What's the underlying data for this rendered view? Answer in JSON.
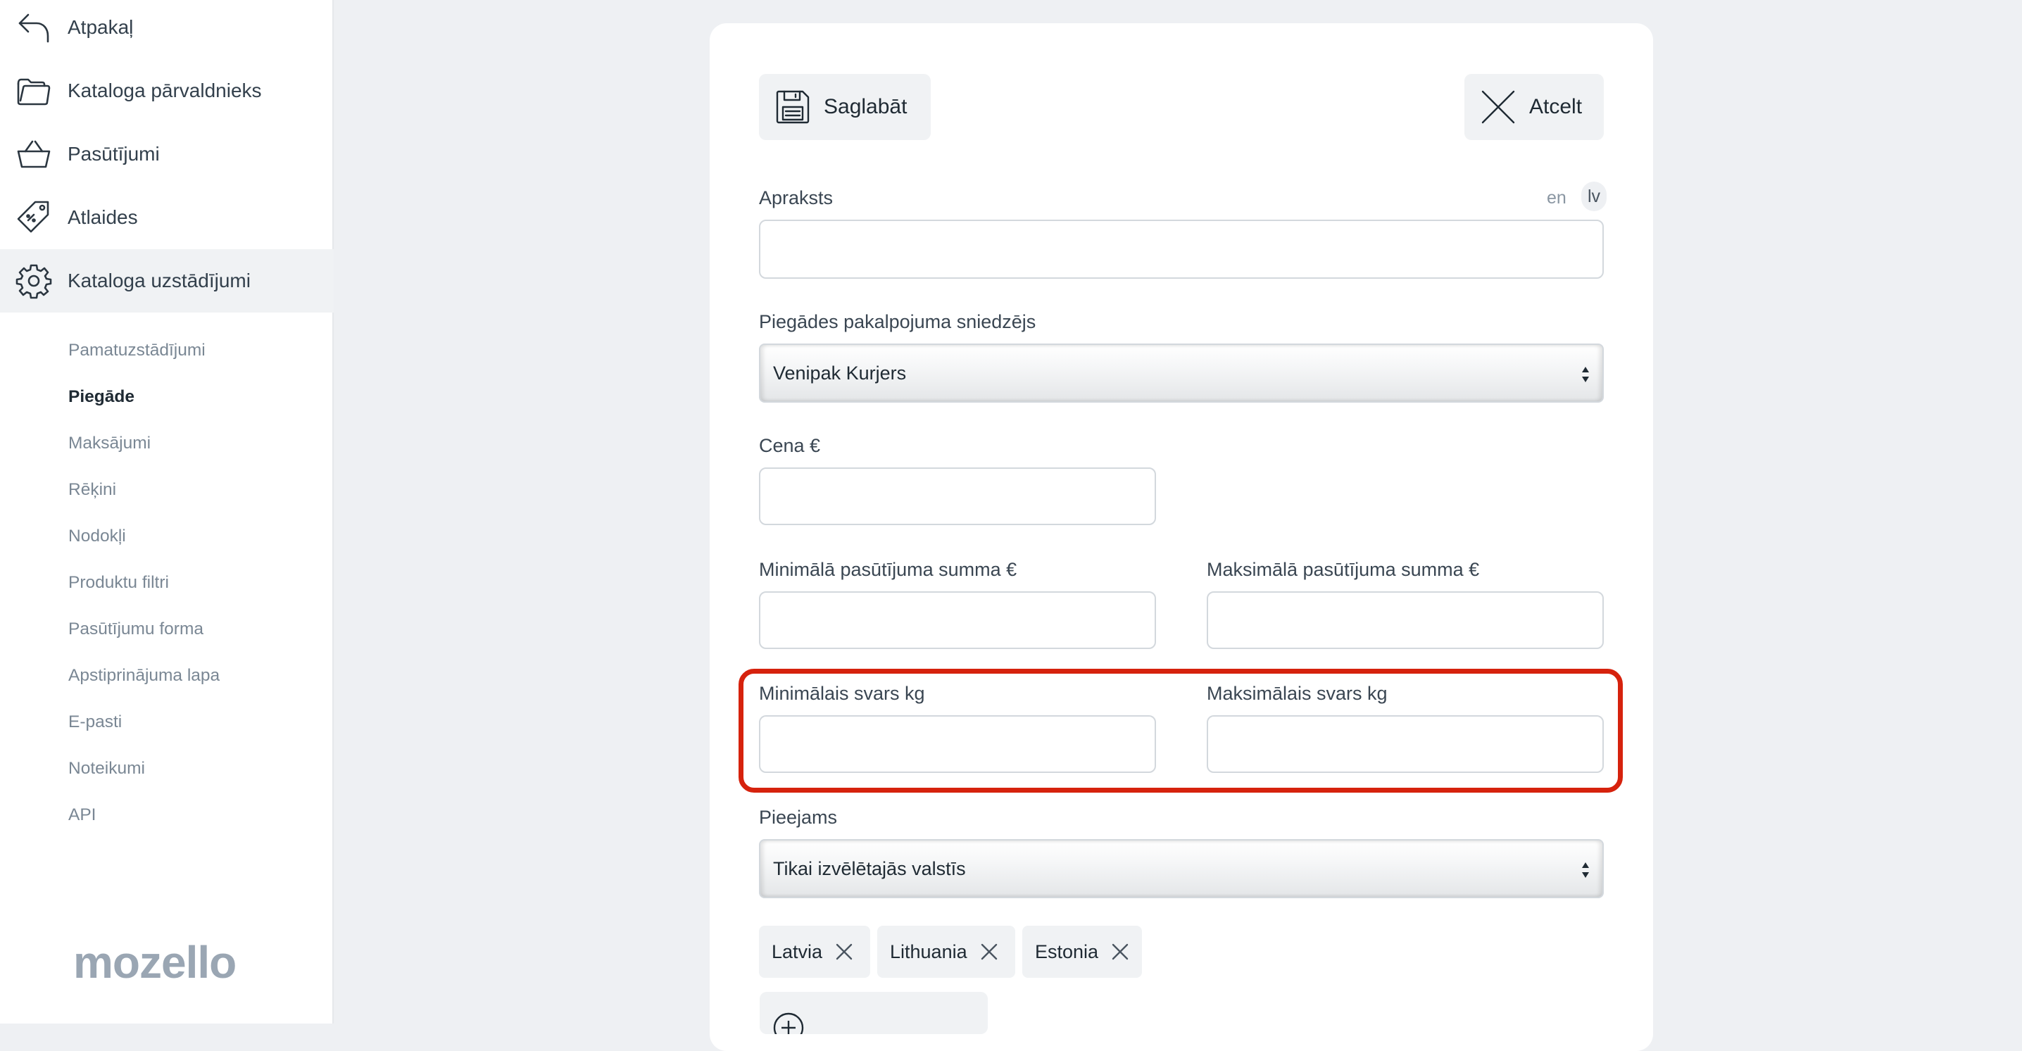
{
  "sidebar": {
    "nav": [
      {
        "label": "Atpakaļ",
        "icon": "back-arrow-icon"
      },
      {
        "label": "Kataloga pārvaldnieks",
        "icon": "folder-icon"
      },
      {
        "label": "Pasūtījumi",
        "icon": "basket-icon"
      },
      {
        "label": "Atlaides",
        "icon": "discount-tag-icon"
      },
      {
        "label": "Kataloga uzstādījumi",
        "icon": "gear-icon"
      }
    ],
    "sub": [
      {
        "label": "Pamatuzstādījumi"
      },
      {
        "label": "Piegāde"
      },
      {
        "label": "Maksājumi"
      },
      {
        "label": "Rēķini"
      },
      {
        "label": "Nodokļi"
      },
      {
        "label": "Produktu filtri"
      },
      {
        "label": "Pasūtījumu forma"
      },
      {
        "label": "Apstiprinājuma lapa"
      },
      {
        "label": "E-pasti"
      },
      {
        "label": "Noteikumi"
      },
      {
        "label": "API"
      }
    ],
    "logo": "mozello"
  },
  "toolbar": {
    "save_label": "Saglabāt",
    "cancel_label": "Atcelt"
  },
  "form": {
    "description": {
      "label": "Apraksts",
      "value": "",
      "lang_en": "en",
      "lang_lv": "lv"
    },
    "provider": {
      "label": "Piegādes pakalpojuma sniedzējs",
      "value": "Venipak Kurjers"
    },
    "price": {
      "label": "Cena €",
      "value": ""
    },
    "min_order": {
      "label": "Minimālā pasūtījuma summa €",
      "value": ""
    },
    "max_order": {
      "label": "Maksimālā pasūtījuma summa €",
      "value": ""
    },
    "min_weight": {
      "label": "Minimālais svars kg",
      "value": ""
    },
    "max_weight": {
      "label": "Maksimālais svars kg",
      "value": ""
    },
    "available": {
      "label": "Pieejams",
      "value": "Tikai izvēlētajās valstīs"
    },
    "countries": [
      {
        "label": "Latvia"
      },
      {
        "label": "Lithuania"
      },
      {
        "label": "Estonia"
      }
    ]
  },
  "colors": {
    "highlight": "#d6220d",
    "background": "#eef0f3"
  }
}
